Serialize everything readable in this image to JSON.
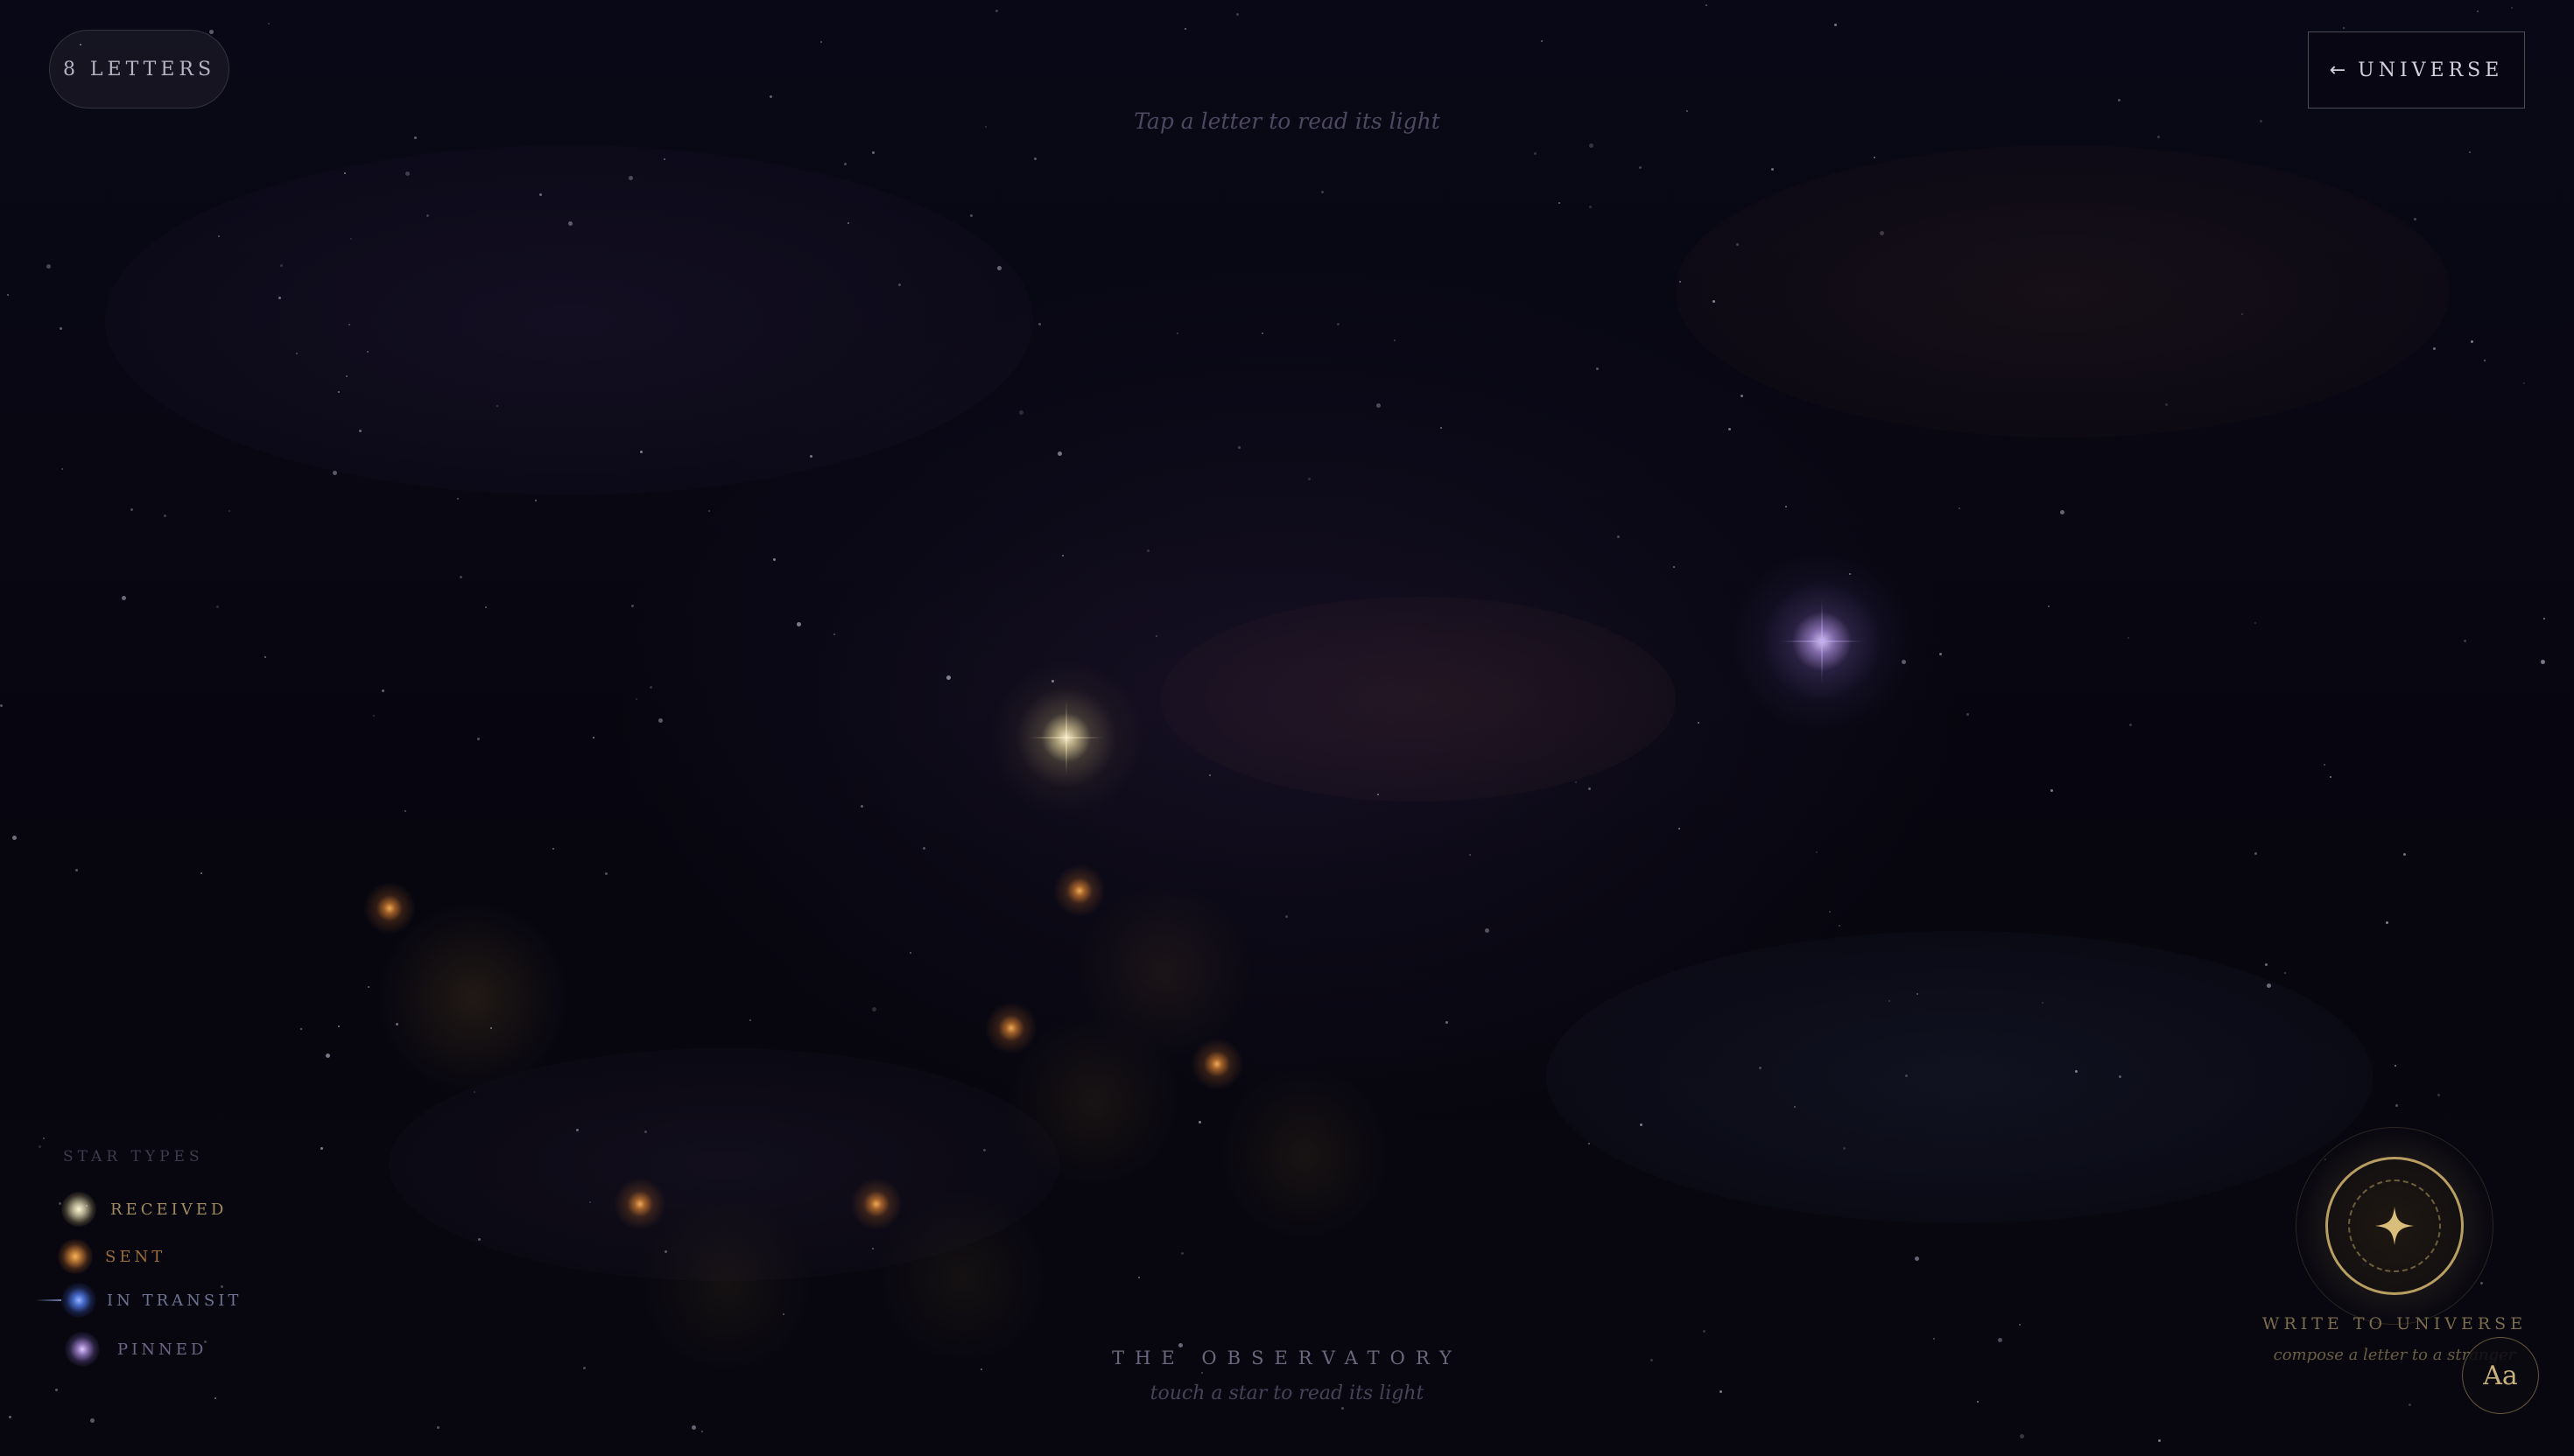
{
  "header": {
    "letter_count": "8 LETTERS",
    "back_label": "UNIVERSE",
    "back_arrow": "←",
    "hint": "Tap a letter to read its light"
  },
  "legend": {
    "title": "STAR TYPES",
    "items": [
      {
        "key": "received",
        "label": "RECEIVED",
        "color": "#e8dfb8"
      },
      {
        "key": "sent",
        "label": "SENT",
        "color": "#d98a3a"
      },
      {
        "key": "in_transit",
        "label": "IN TRANSIT",
        "color": "#4f7ae8"
      },
      {
        "key": "pinned",
        "label": "PINNED",
        "color": "#a98ad8"
      }
    ]
  },
  "footer": {
    "title": "THE OBSERVATORY",
    "subtitle": "touch a star to read its light"
  },
  "compose": {
    "label": "WRITE TO UNIVERSE",
    "sublabel": "compose a letter to a stranger",
    "font_button": "Aa"
  },
  "letters": [
    {
      "id": "received-1",
      "type": "received"
    },
    {
      "id": "pinned-1",
      "type": "pinned"
    },
    {
      "id": "sent-1",
      "type": "sent"
    },
    {
      "id": "sent-2",
      "type": "sent"
    },
    {
      "id": "sent-3",
      "type": "sent"
    },
    {
      "id": "sent-4",
      "type": "sent"
    },
    {
      "id": "sent-5",
      "type": "sent"
    },
    {
      "id": "sent-6",
      "type": "sent"
    }
  ],
  "colors": {
    "background": "#07060f",
    "accent_gold": "#d6b870"
  }
}
